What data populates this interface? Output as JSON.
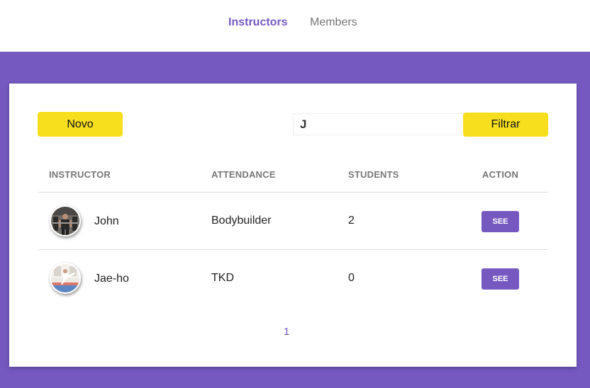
{
  "nav": {
    "items": [
      {
        "label": "Instructors",
        "active": true
      },
      {
        "label": "Members",
        "active": false
      }
    ]
  },
  "toolbar": {
    "new_label": "Novo",
    "search_value": "J",
    "filter_label": "Filtrar"
  },
  "table": {
    "headers": [
      "INSTRUCTOR",
      "ATTENDANCE",
      "STUDENTS",
      "ACTION"
    ],
    "rows": [
      {
        "name": "John",
        "attendance": "Bodybuilder",
        "students": "2",
        "action": "SEE",
        "avatar": "gym-photo"
      },
      {
        "name": "Jae-ho",
        "attendance": "TKD",
        "students": "0",
        "action": "SEE",
        "avatar": "taekwondo-photo"
      }
    ]
  },
  "pagination": {
    "pages": [
      "1"
    ],
    "current": "1"
  },
  "colors": {
    "accent": "#7559c1",
    "button_yellow": "#f7df1e",
    "header_text": "#777777"
  }
}
